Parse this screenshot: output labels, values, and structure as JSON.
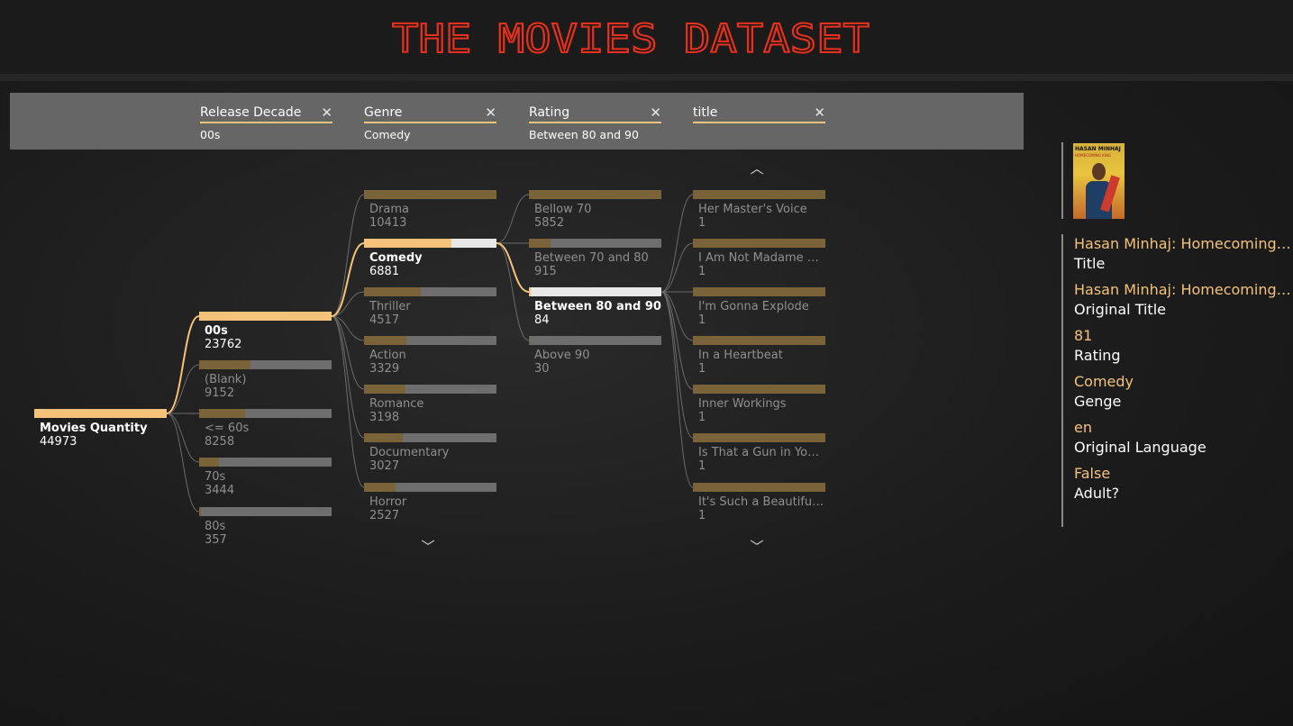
{
  "header": {
    "title": "THE MOVIES DATASET"
  },
  "filters": [
    {
      "name": "Release Decade",
      "value": "00s"
    },
    {
      "name": "Genre",
      "value": "Comedy"
    },
    {
      "name": "Rating",
      "value": "Between 80 and 90"
    },
    {
      "name": "title",
      "value": ""
    }
  ],
  "clear_symbol": "✕",
  "root": {
    "label": "Movies Quantity",
    "value": "44973"
  },
  "decade_nodes": [
    {
      "label": "00s",
      "value": "23762",
      "selected": true,
      "fill": 1.0
    },
    {
      "label": "(Blank)",
      "value": "9152",
      "fill": 0.39
    },
    {
      "label": "<= 60s",
      "value": "8258",
      "fill": 0.35
    },
    {
      "label": "70s",
      "value": "3444",
      "fill": 0.15
    },
    {
      "label": "80s",
      "value": "357",
      "fill": 0.015
    }
  ],
  "genre_nodes": [
    {
      "label": "Drama",
      "value": "10413",
      "fill": 1.0
    },
    {
      "label": "Comedy",
      "value": "6881",
      "selected": true,
      "fill": 0.66
    },
    {
      "label": "Thriller",
      "value": "4517",
      "fill": 0.43
    },
    {
      "label": "Action",
      "value": "3329",
      "fill": 0.32
    },
    {
      "label": "Romance",
      "value": "3198",
      "fill": 0.31
    },
    {
      "label": "Documentary",
      "value": "3027",
      "fill": 0.29
    },
    {
      "label": "Horror",
      "value": "2527",
      "fill": 0.24
    }
  ],
  "rating_nodes": [
    {
      "label": "Bellow 70",
      "value": "5852",
      "fill": 1.0
    },
    {
      "label": "Between 70 and 80",
      "value": "915",
      "fill": 0.16
    },
    {
      "label": "Between 80 and 90",
      "value": "84",
      "selected": true,
      "fill": 0.014
    },
    {
      "label": "Above 90",
      "value": "30",
      "fill": 0.005
    }
  ],
  "title_nodes": [
    {
      "label": "Her Master's Voice",
      "value": "1",
      "fill": 1.0
    },
    {
      "label": "I Am Not Madame Bov...",
      "value": "1",
      "fill": 1.0
    },
    {
      "label": "I'm Gonna Explode",
      "value": "1",
      "fill": 1.0
    },
    {
      "label": "In a Heartbeat",
      "value": "1",
      "fill": 1.0
    },
    {
      "label": "Inner Workings",
      "value": "1",
      "fill": 1.0
    },
    {
      "label": "Is That a Gun in Your P...",
      "value": "1",
      "fill": 1.0
    },
    {
      "label": "It's Such a Beautiful Day",
      "value": "1",
      "fill": 1.0
    }
  ],
  "scroll": {
    "up": "︿",
    "down": "﹀"
  },
  "card": {
    "poster_title": "HASAN MINHAJ",
    "poster_subtitle": "HOMECOMING KING",
    "fields": [
      {
        "value": "Hasan Minhaj: Homecoming King",
        "label": "Title"
      },
      {
        "value": "Hasan Minhaj: Homecoming King",
        "label": "Original Title"
      },
      {
        "value": "81",
        "label": "Rating"
      },
      {
        "value": "Comedy",
        "label": "Genge"
      },
      {
        "value": "en",
        "label": "Original Language"
      },
      {
        "value": "False",
        "label": "Adult?"
      }
    ]
  },
  "colors": {
    "accent": "#f5c27a",
    "title_neon": "#e8301c",
    "panel": "#666666"
  }
}
